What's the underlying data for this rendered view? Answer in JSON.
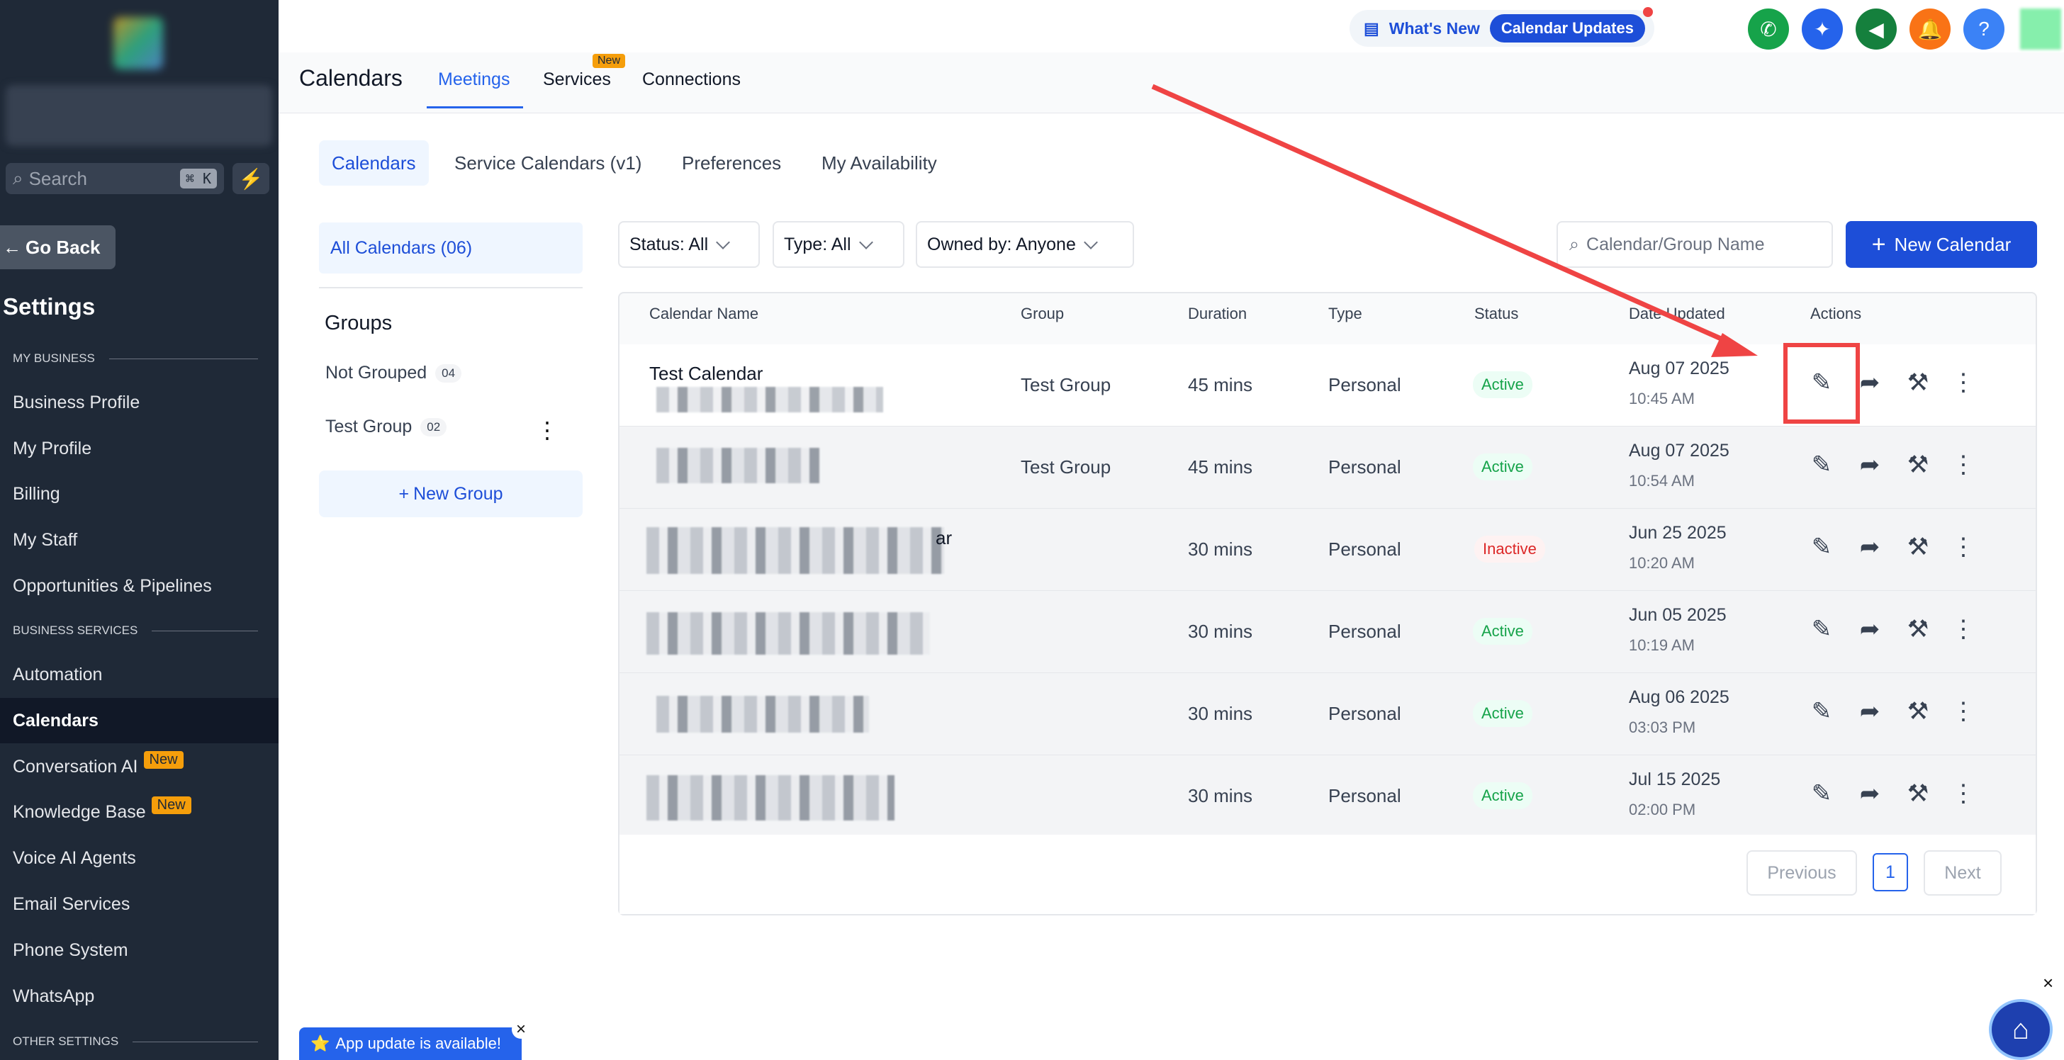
{
  "sidebar": {
    "search_placeholder": "Search",
    "search_kbd": "⌘ K",
    "go_back": "Go Back",
    "title": "Settings",
    "sections": {
      "my_business": "MY BUSINESS",
      "business_services": "BUSINESS SERVICES",
      "other_settings": "OTHER SETTINGS"
    },
    "items": [
      "Business Profile",
      "My Profile",
      "Billing",
      "My Staff",
      "Opportunities & Pipelines",
      "Automation",
      "Calendars",
      "Conversation AI",
      "Knowledge Base",
      "Voice AI Agents",
      "Email Services",
      "Phone System",
      "WhatsApp"
    ],
    "new_tag": "New",
    "toast": "App update is available!"
  },
  "topbar": {
    "whats_new": "What's New",
    "calendar_updates": "Calendar Updates",
    "help": "?"
  },
  "page": {
    "title": "Calendars",
    "tabs": [
      "Meetings",
      "Services",
      "Connections"
    ],
    "new_badge": "New"
  },
  "subtabs": [
    "Calendars",
    "Service Calendars (v1)",
    "Preferences",
    "My Availability"
  ],
  "left": {
    "all_calendars": "All Calendars (06)",
    "groups_heading": "Groups",
    "groups": [
      {
        "name": "Not Grouped",
        "count": "04"
      },
      {
        "name": "Test Group",
        "count": "02"
      }
    ],
    "new_group": "New Group"
  },
  "filters": {
    "status": "Status: All",
    "type": "Type: All",
    "owner": "Owned by: Anyone",
    "search_placeholder": "Calendar/Group Name",
    "new_calendar": "New Calendar"
  },
  "table": {
    "headers": [
      "Calendar Name",
      "Group",
      "Duration",
      "Type",
      "Status",
      "Date Updated",
      "Actions"
    ],
    "rows": [
      {
        "name": "Test Calendar",
        "group": "Test Group",
        "duration": "45 mins",
        "type": "Personal",
        "status": "Active",
        "date": "Aug 07 2025",
        "time": "10:45 AM"
      },
      {
        "name": "",
        "group": "Test Group",
        "duration": "45 mins",
        "type": "Personal",
        "status": "Active",
        "date": "Aug 07 2025",
        "time": "10:54 AM"
      },
      {
        "name": "ar",
        "group": "",
        "duration": "30 mins",
        "type": "Personal",
        "status": "Inactive",
        "date": "Jun 25 2025",
        "time": "10:20 AM"
      },
      {
        "name": "",
        "group": "",
        "duration": "30 mins",
        "type": "Personal",
        "status": "Active",
        "date": "Jun 05 2025",
        "time": "10:19 AM"
      },
      {
        "name": "",
        "group": "",
        "duration": "30 mins",
        "type": "Personal",
        "status": "Active",
        "date": "Aug 06 2025",
        "time": "03:03 PM"
      },
      {
        "name": "",
        "group": "",
        "duration": "30 mins",
        "type": "Personal",
        "status": "Active",
        "date": "Jul 15 2025",
        "time": "02:00 PM"
      }
    ],
    "pagination": {
      "previous": "Previous",
      "page": "1",
      "next": "Next"
    }
  },
  "colors": {
    "primary": "#1d4ed8",
    "active_green": "#16a34a",
    "inactive_red": "#dc2626",
    "annotation": "#ef4444"
  }
}
